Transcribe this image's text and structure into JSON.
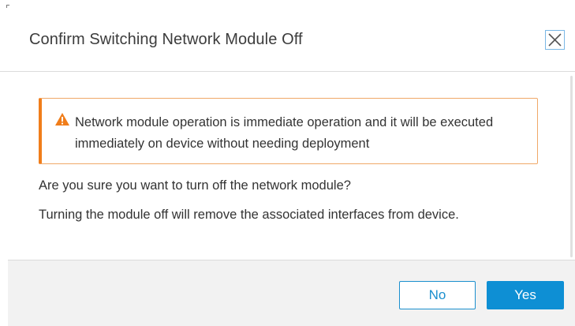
{
  "dialog": {
    "title": "Confirm Switching Network Module Off",
    "close_icon": "close-icon"
  },
  "alert": {
    "icon": "warning-icon",
    "message": "Network module operation is immediate operation and it will be executed immediately on device without needing deployment",
    "accent_color": "#f07d1a"
  },
  "content": {
    "question": "Are you sure you want to turn off the network module?",
    "info": "Turning the module off will remove the associated interfaces from device."
  },
  "footer": {
    "no_label": "No",
    "yes_label": "Yes",
    "primary_color": "#0e8fd4"
  }
}
